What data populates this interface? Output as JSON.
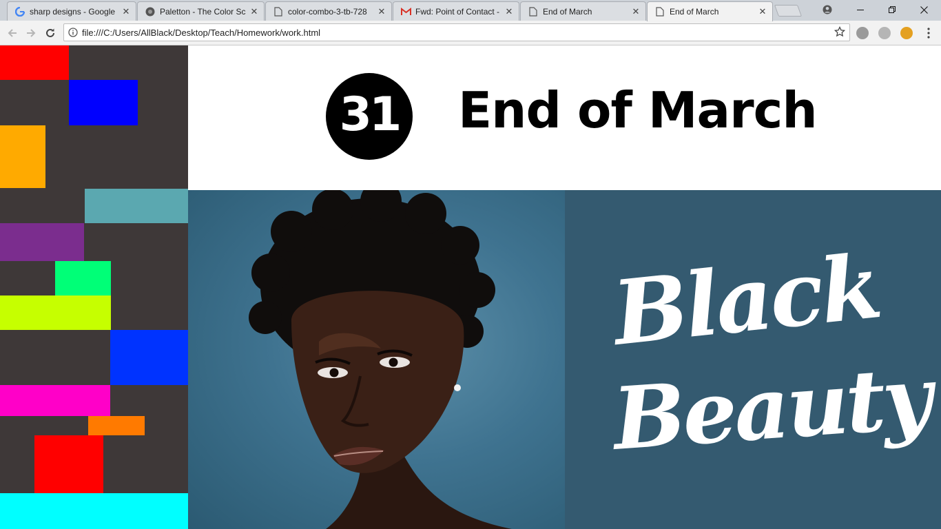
{
  "browser": {
    "tabs": [
      {
        "title": "sharp designs - Google",
        "icon": "google-icon"
      },
      {
        "title": "Paletton - The Color Sc",
        "icon": "paletton-icon"
      },
      {
        "title": "color-combo-3-tb-728",
        "icon": "file-icon"
      },
      {
        "title": "Fwd: Point of Contact -",
        "icon": "gmail-icon"
      },
      {
        "title": "End of March",
        "icon": "file-icon"
      },
      {
        "title": "End of March",
        "icon": "file-icon",
        "active": true
      }
    ],
    "close_glyph": "✕",
    "url": "file:///C:/Users/AllBlack/Desktop/Teach/Homework/work.html"
  },
  "page": {
    "day_number": "31",
    "title": "End of March",
    "banner_line1": "Black",
    "banner_line2": "Beauty",
    "colors": {
      "mosaic_bg": "#3e3838",
      "banner_bg": "#345a70",
      "blocks": [
        "#ff0000",
        "#0000ff",
        "#ffaa00",
        "#5ba8b0",
        "#7b2d8e",
        "#00ff77",
        "#c6ff00",
        "#0033ff",
        "#ff00c8",
        "#ff7a00",
        "#ff0000",
        "#00ffff"
      ]
    }
  }
}
